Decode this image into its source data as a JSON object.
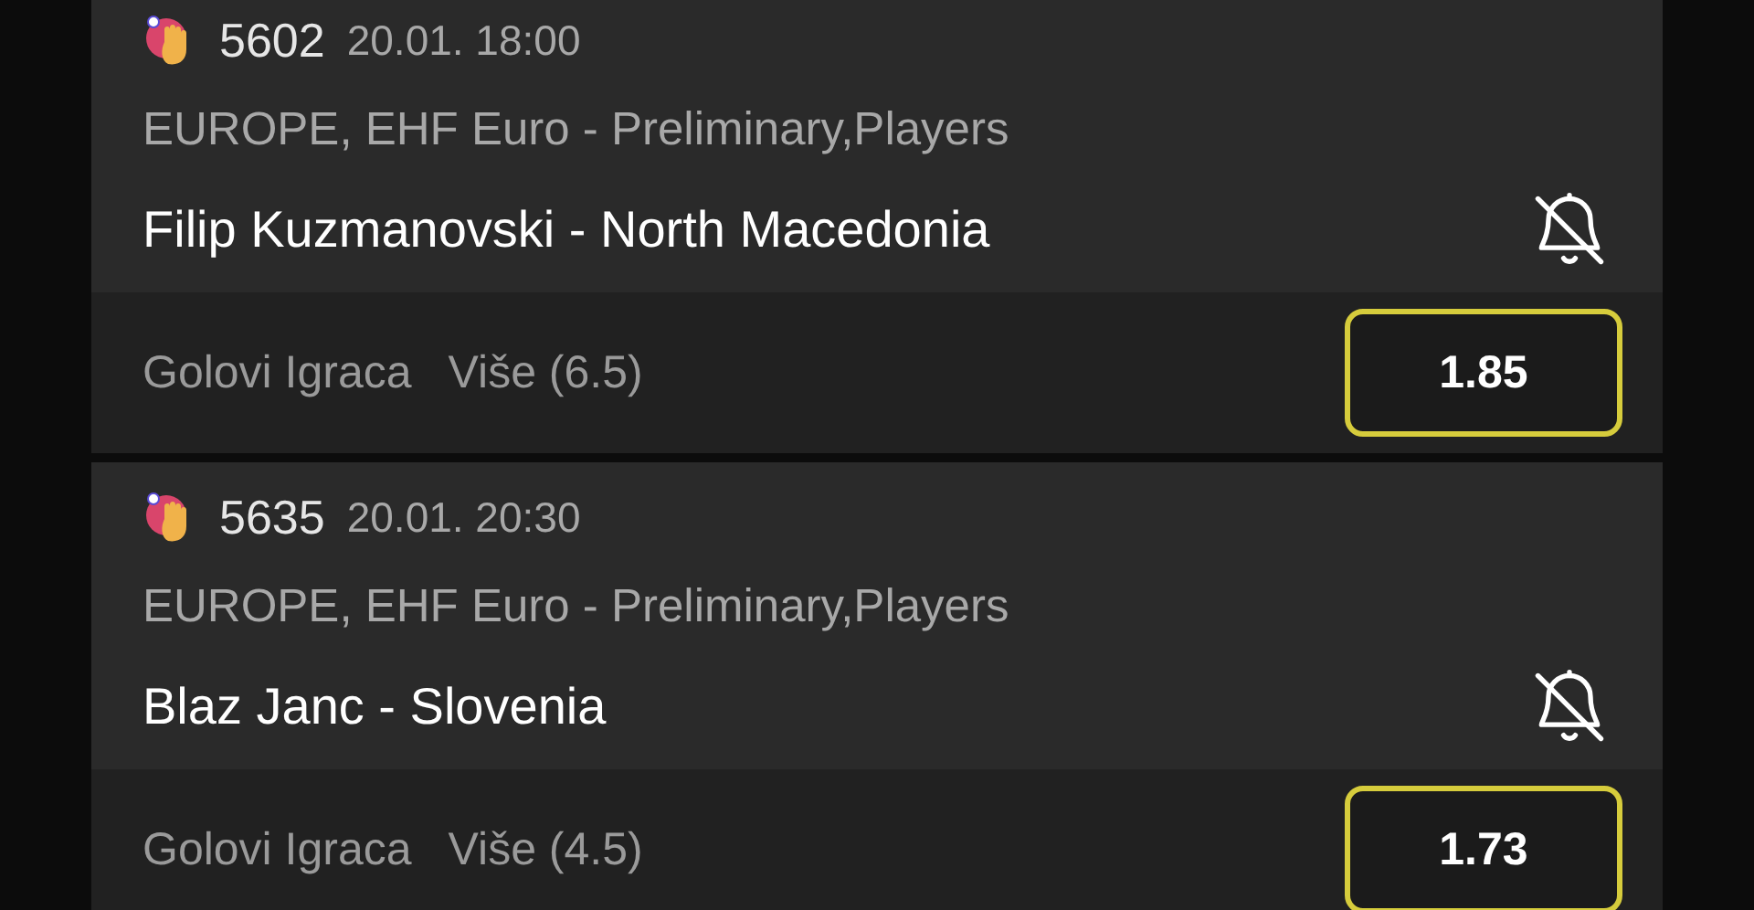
{
  "events": [
    {
      "code": "5602",
      "time": "20.01. 18:00",
      "league": "EUROPE, EHF Euro - Preliminary,Players",
      "match": "Filip Kuzmanovski - North Macedonia",
      "notifications_on": false,
      "market": "Golovi Igraca",
      "selection": "Više (6.5)",
      "odds": "1.85",
      "selected": true
    },
    {
      "code": "5635",
      "time": "20.01. 20:30",
      "league": "EUROPE, EHF Euro - Preliminary,Players",
      "match": "Blaz Janc - Slovenia",
      "notifications_on": false,
      "market": "Golovi Igraca",
      "selection": "Više (4.5)",
      "odds": "1.73",
      "selected": true
    }
  ]
}
